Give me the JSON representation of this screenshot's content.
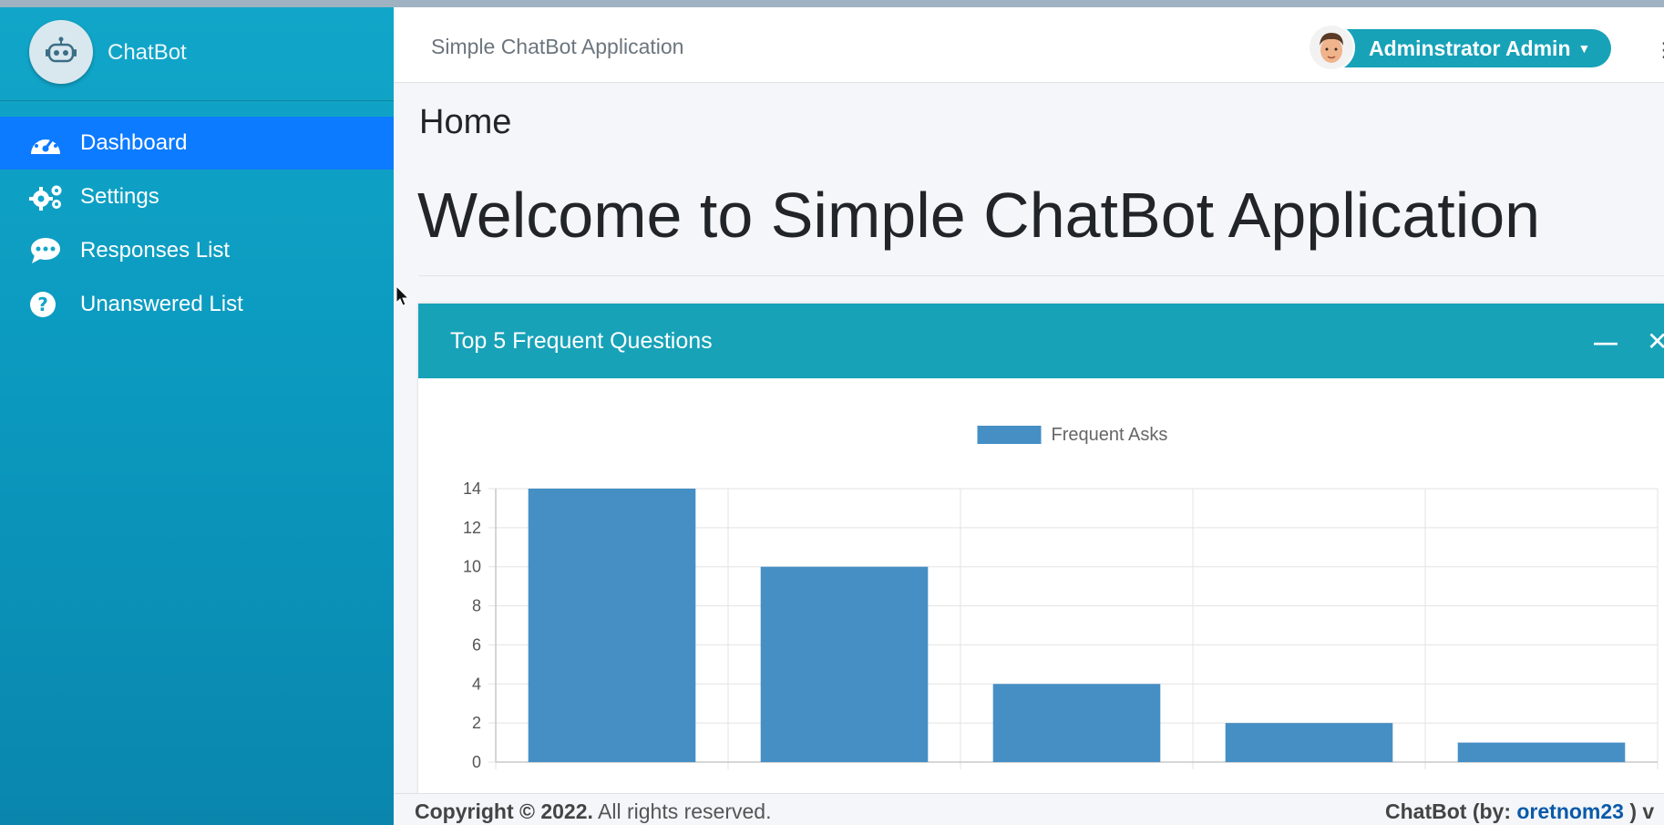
{
  "sidebar": {
    "brand": "ChatBot",
    "items": [
      {
        "label": "Dashboard",
        "icon": "tachometer-icon",
        "active": true
      },
      {
        "label": "Settings",
        "icon": "gears-icon",
        "active": false
      },
      {
        "label": "Responses List",
        "icon": "comment-dots-icon",
        "active": false
      },
      {
        "label": "Unanswered List",
        "icon": "question-circle-icon",
        "active": false
      }
    ]
  },
  "header": {
    "title": "Simple ChatBot Application",
    "user_name": "Adminstrator Admin"
  },
  "main": {
    "breadcrumb": "Home",
    "welcome": "Welcome to Simple ChatBot Application"
  },
  "card": {
    "title": "Top 5 Frequent Questions",
    "minimize_label": "—",
    "close_label": "✕"
  },
  "chart_data": {
    "type": "bar",
    "categories": [
      "",
      "",
      "",
      "",
      ""
    ],
    "series": [
      {
        "name": "Frequent Asks",
        "values": [
          14,
          10,
          4,
          2,
          1
        ]
      }
    ],
    "ylim": [
      0,
      14
    ],
    "yticks": [
      0,
      2,
      4,
      6,
      8,
      10,
      12,
      14
    ],
    "grid": true,
    "legend": "top-center",
    "color": "#468fc5"
  },
  "footer": {
    "copyright": "Copyright © 2022.",
    "rights": "All rights reserved.",
    "credit_prefix": "ChatBot (by: ",
    "credit_author": "oretnom23",
    "credit_suffix": " ) v"
  },
  "colors": {
    "sidebar": "#11a6c9",
    "active": "#0d7bff",
    "card_header": "#17a2b8"
  }
}
